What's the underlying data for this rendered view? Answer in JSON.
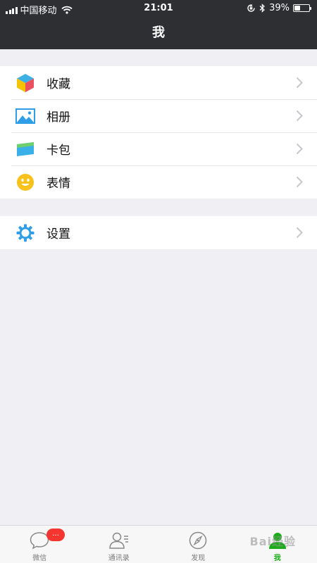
{
  "status_bar": {
    "carrier": "中国移动",
    "time": "21:01",
    "battery_percent": "39%",
    "battery_level": 0.39,
    "icons": [
      "signal-icon",
      "wifi-icon",
      "orientation-lock-icon",
      "bluetooth-icon",
      "battery-icon"
    ]
  },
  "nav": {
    "title": "我"
  },
  "groups": [
    {
      "items": [
        {
          "label": "收藏",
          "icon": "favorites-cube-icon"
        },
        {
          "label": "相册",
          "icon": "album-icon"
        },
        {
          "label": "卡包",
          "icon": "card-wallet-icon"
        },
        {
          "label": "表情",
          "icon": "smiley-icon"
        }
      ]
    },
    {
      "items": [
        {
          "label": "设置",
          "icon": "settings-gear-icon"
        }
      ]
    }
  ],
  "tab_bar": {
    "tabs": [
      {
        "label": "微信",
        "icon": "chat-bubble-icon",
        "badge": "…"
      },
      {
        "label": "通讯录",
        "icon": "contacts-icon"
      },
      {
        "label": "发现",
        "icon": "compass-icon"
      },
      {
        "label": "我",
        "icon": "person-icon",
        "active": true
      }
    ]
  },
  "colors": {
    "header_bg": "#2e2f33",
    "page_bg": "#efeff4",
    "active_green": "#1aad19",
    "badge_red": "#f43530"
  },
  "watermark": "Bai经验"
}
